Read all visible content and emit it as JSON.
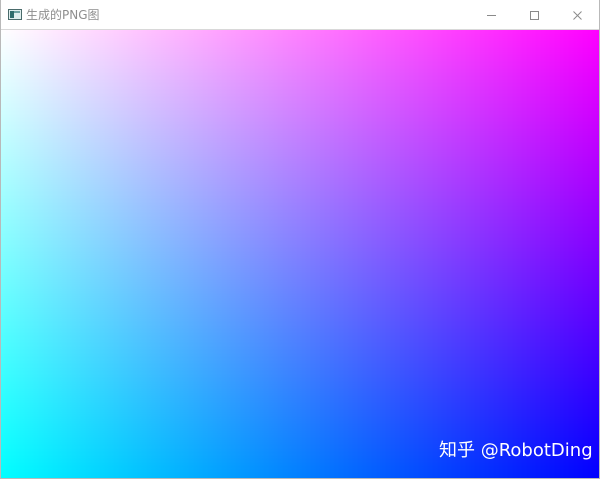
{
  "window": {
    "title": "生成的PNG图",
    "icons": {
      "app": "image-viewer-icon",
      "minimize": "minimize-icon",
      "maximize": "maximize-icon",
      "close": "close-icon"
    }
  },
  "canvas": {
    "gradient_corners": {
      "top_left": "#ffffff",
      "top_right": "#ff00ff",
      "bottom_left": "#00ffff",
      "bottom_right": "#0000ff"
    }
  },
  "watermark": {
    "text": "知乎 @RobotDing",
    "color": "#ffffff"
  }
}
